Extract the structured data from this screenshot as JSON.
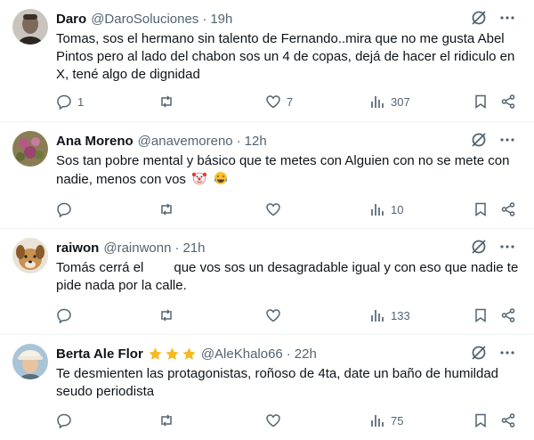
{
  "tweets": [
    {
      "name": "Daro",
      "handle": "@DaroSoluciones",
      "time": "19h",
      "text": "Tomas, sos el hermano sin talento de Fernando..mira que no me gusta Abel Pintos pero  al lado del chabon sos un 4 de copas, dejá de hacer el ridiculo en X, tené algo de dignidad",
      "reply_count": "1",
      "retweet_count": "",
      "like_count": "7",
      "view_count": "307"
    },
    {
      "name": "Ana Moreno",
      "handle": "@anavemoreno",
      "time": "12h",
      "text": "Sos tan pobre mental y básico que te metes con Alguien con no se mete con nadie, menos con vos",
      "reply_count": "",
      "retweet_count": "",
      "like_count": "",
      "view_count": "10",
      "emojis": [
        "clown-face-emoji",
        "tears-of-joy-emoji"
      ]
    },
    {
      "name": "raiwon",
      "handle": "@rainwonn",
      "time": "21h",
      "text_before": "Tomás cerrá el",
      "text_after": "que vos sos un desagradable igual y con eso que nadie te pide nada por la calle.",
      "reply_count": "",
      "retweet_count": "",
      "like_count": "",
      "view_count": "133"
    },
    {
      "name": "Berta Ale Flor",
      "name_decoration": [
        "star-emoji",
        "star-emoji",
        "star-emoji"
      ],
      "handle": "@AleKhalo66",
      "time": "22h",
      "text": "Te desmienten las protagonistas, roñoso de 4ta, date un baño de humildad seudo periodista",
      "reply_count": "",
      "retweet_count": "",
      "like_count": "",
      "view_count": "75"
    }
  ],
  "separator": "·",
  "colors": {
    "text": "#0f1419",
    "muted": "#536471",
    "divider": "#eff3f4",
    "star": "#f5b921"
  }
}
